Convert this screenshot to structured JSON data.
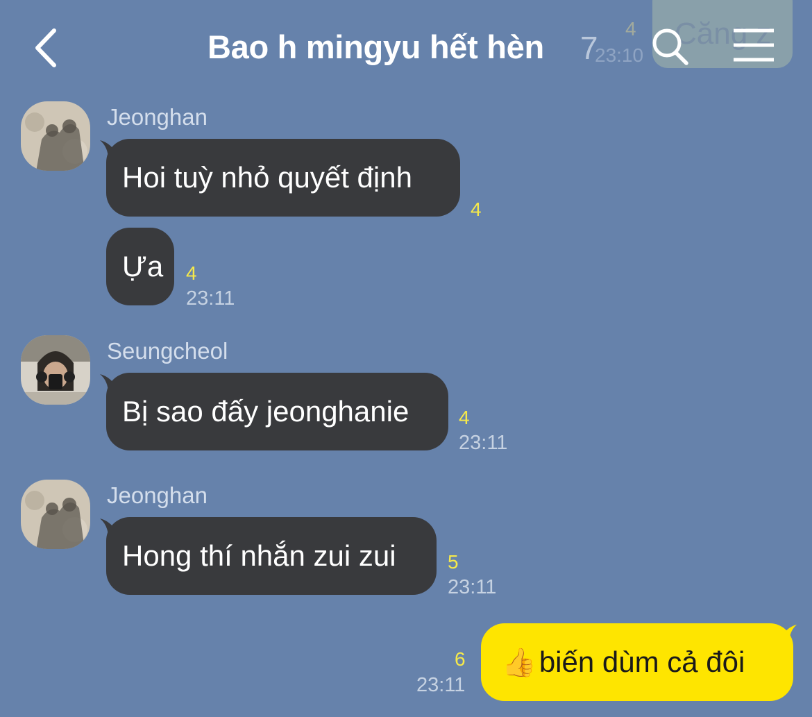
{
  "header": {
    "title": "Bao h mingyu hết hèn",
    "member_count": "7"
  },
  "background_peek": {
    "unread": "4",
    "time": "23:10",
    "text": "Căng z"
  },
  "messages": [
    {
      "sender": "Jeonghan",
      "text": "Hoi tuỳ nhỏ quyết định",
      "unread": "4",
      "time": ""
    },
    {
      "sender": "",
      "text": "Ựa",
      "unread": "4",
      "time": "23:11"
    },
    {
      "sender": "Seungcheol",
      "text": "Bị sao đấy jeonghanie",
      "unread": "4",
      "time": "23:11"
    },
    {
      "sender": "Jeonghan",
      "text": "Hong thí nhắn zui zui",
      "unread": "5",
      "time": "23:11"
    },
    {
      "sender": "",
      "text": "biến dùm cả đôi",
      "emoji": "👍",
      "unread": "6",
      "time": "23:11",
      "mine": true
    }
  ],
  "icons": {
    "back": "chevron-left-icon",
    "search": "search-icon",
    "menu": "menu-icon"
  },
  "colors": {
    "background": "#6682ab",
    "incoming_bubble": "#393a3d",
    "outgoing_bubble": "#fee500",
    "unread": "#f6e94a"
  }
}
